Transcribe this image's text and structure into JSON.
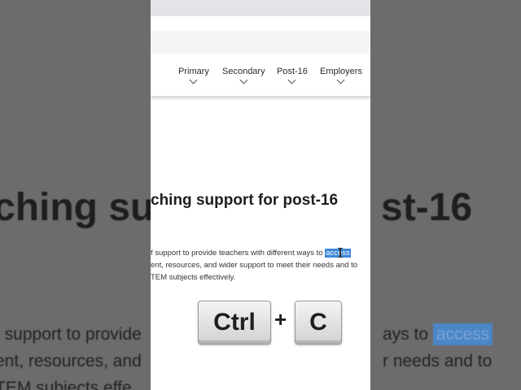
{
  "background": {
    "heading_left": "ching su",
    "heading_right": "st-16",
    "lines_left": [
      "f support to provide",
      "ent, resources, and",
      "TEM subjects effe"
    ],
    "lines_right_1_pre": "ays to ",
    "lines_right_1_hl": "access",
    "lines_right_2": "r needs and to"
  },
  "nav": {
    "items": [
      {
        "label": "Primary"
      },
      {
        "label": "Secondary"
      },
      {
        "label": "Post-16"
      },
      {
        "label": "Employers"
      }
    ]
  },
  "content": {
    "heading": "ching support for post-16",
    "line1_pre": "f support to provide teachers with different ways to ",
    "line1_hl": "access",
    "line2": "ent, resources, and wider support to meet their needs and to",
    "line3": "TEM subjects effectively."
  },
  "shortcut": {
    "key1": "Ctrl",
    "plus": "+",
    "key2": "C"
  },
  "colors": {
    "highlight": "#3f86d8",
    "background_overlay": "#6a6a6a"
  }
}
